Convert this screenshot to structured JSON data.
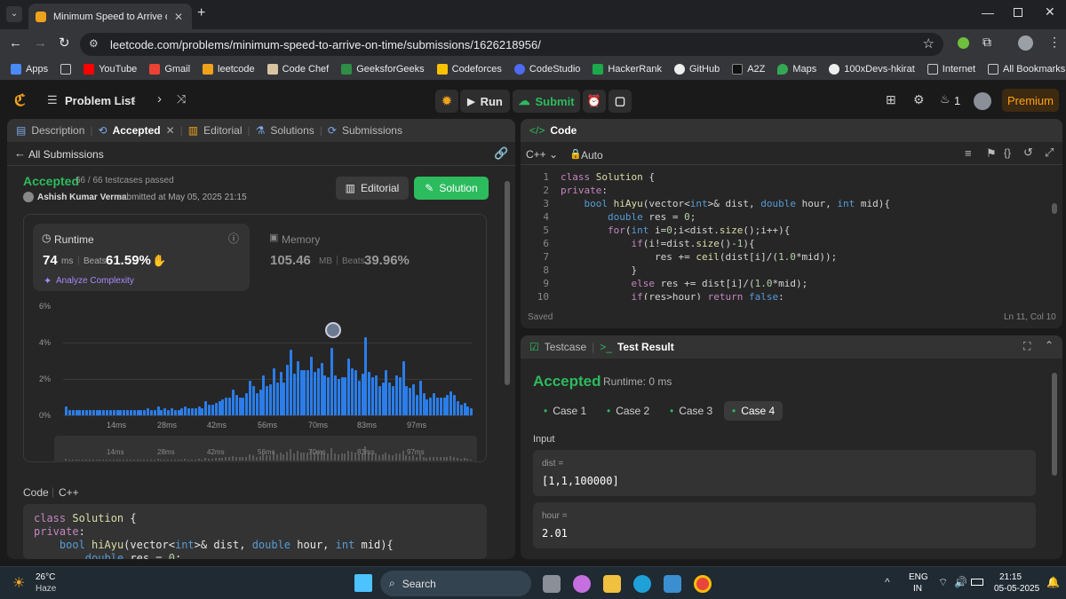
{
  "browser": {
    "tab_title": "Minimum Speed to Arrive on Ti",
    "url": "leetcode.com/problems/minimum-speed-to-arrive-on-time/submissions/1626218956/",
    "bookmarks": [
      "Apps",
      "YouTube",
      "Gmail",
      "leetcode",
      "Code Chef",
      "GeeksforGeeks",
      "Codeforces",
      "CodeStudio",
      "HackerRank",
      "GitHub",
      "A2Z",
      "Maps",
      "100xDevs-hkirat",
      "Internet"
    ],
    "all_bookmarks": "All Bookmarks"
  },
  "nav": {
    "problem_list": "Problem List",
    "run": "Run",
    "submit": "Submit",
    "streak": "1",
    "premium": "Premium"
  },
  "left_tabs": {
    "description": "Description",
    "accepted": "Accepted",
    "editorial": "Editorial",
    "solutions": "Solutions",
    "submissions": "Submissions"
  },
  "submission": {
    "back": "All Submissions",
    "status": "Accepted",
    "tests": "66 / 66 testcases passed",
    "author": "Ashish Kumar Verma",
    "submitted": "submitted at May 05, 2025 21:15",
    "editorial_btn": "Editorial",
    "solution_btn": "Solution"
  },
  "runtime": {
    "label": "Runtime",
    "value": "74",
    "unit": "ms",
    "beats_label": "Beats",
    "beats": "61.59%",
    "analyze": "Analyze Complexity"
  },
  "memory": {
    "label": "Memory",
    "value": "105.46",
    "unit": "MB",
    "beats_label": "Beats",
    "beats": "39.96%"
  },
  "chart_data": {
    "type": "bar",
    "ylabels": [
      "6%",
      "4%",
      "2%",
      "0%"
    ],
    "ylim": [
      0,
      6
    ],
    "xticks": [
      "14ms",
      "28ms",
      "42ms",
      "56ms",
      "70ms",
      "83ms",
      "97ms"
    ],
    "values": [
      0.5,
      0.3,
      0.3,
      0.3,
      0.3,
      0.3,
      0.3,
      0.3,
      0.3,
      0.3,
      0.3,
      0.3,
      0.3,
      0.3,
      0.3,
      0.3,
      0.3,
      0.3,
      0.3,
      0.3,
      0.3,
      0.3,
      0.3,
      0.3,
      0.4,
      0.3,
      0.3,
      0.5,
      0.3,
      0.4,
      0.3,
      0.4,
      0.3,
      0.3,
      0.4,
      0.5,
      0.4,
      0.4,
      0.4,
      0.5,
      0.4,
      0.8,
      0.6,
      0.6,
      0.7,
      0.8,
      0.9,
      1.0,
      1.0,
      1.4,
      1.1,
      1.0,
      1.0,
      1.2,
      1.9,
      1.6,
      1.2,
      1.4,
      2.2,
      1.6,
      1.7,
      2.6,
      1.8,
      2.4,
      1.8,
      2.8,
      3.6,
      2.3,
      3.0,
      2.5,
      2.5,
      2.5,
      3.2,
      2.4,
      2.6,
      2.9,
      2.2,
      2.1,
      3.7,
      2.2,
      2.0,
      2.1,
      2.1,
      3.1,
      2.6,
      2.5,
      1.9,
      2.3,
      4.3,
      2.4,
      2.1,
      2.2,
      1.6,
      1.8,
      2.5,
      1.8,
      1.6,
      2.2,
      2.1,
      3.0,
      1.6,
      1.5,
      1.7,
      1.1,
      1.9,
      1.2,
      0.9,
      1.0,
      1.2,
      1.0,
      1.0,
      1.0,
      1.1,
      1.3,
      1.1,
      0.8,
      0.6,
      0.7,
      0.5,
      0.4
    ]
  },
  "code_section": {
    "label": "Code",
    "lang": "C++"
  },
  "editor": {
    "title": "Code",
    "lang": "C++",
    "mode": "Auto",
    "saved": "Saved",
    "cursor": "Ln 11, Col 10",
    "line_numbers": [
      "1",
      "2",
      "3",
      "4",
      "5",
      "6",
      "7",
      "8",
      "9",
      "10"
    ]
  },
  "result": {
    "testcase_tab": "Testcase",
    "result_tab": "Test Result",
    "status": "Accepted",
    "runtime": "Runtime: 0 ms",
    "cases": [
      "Case 1",
      "Case 2",
      "Case 3",
      "Case 4"
    ],
    "input_label": "Input",
    "dist_label": "dist =",
    "dist_value": "[1,1,100000]",
    "hour_label": "hour =",
    "hour_value": "2.01"
  },
  "taskbar": {
    "temp": "26°C",
    "weather": "Haze",
    "search": "Search",
    "lang": "ENG",
    "region": "IN",
    "time": "21:15",
    "date": "05-05-2025"
  }
}
